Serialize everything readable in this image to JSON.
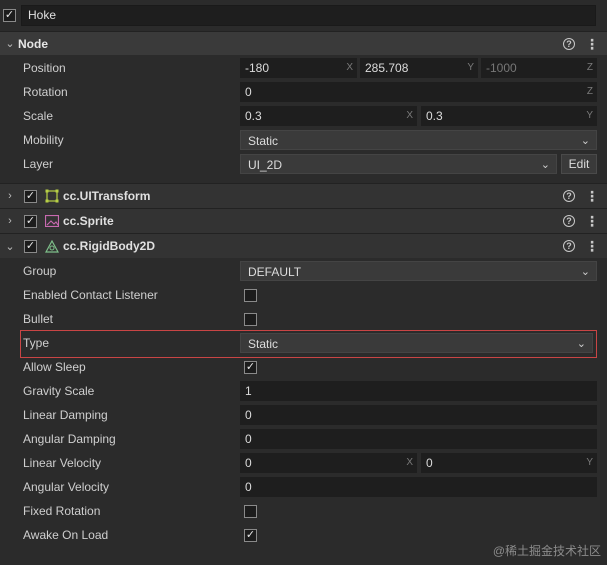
{
  "node_name": {
    "enabled": true,
    "value": "Hoke"
  },
  "node_section": {
    "title": "Node",
    "position": {
      "label": "Position",
      "x": "-180",
      "y": "285.708",
      "z": "-1000",
      "axis_x": "X",
      "axis_y": "Y",
      "axis_z": "Z"
    },
    "rotation": {
      "label": "Rotation",
      "z": "0",
      "axis_z": "Z"
    },
    "scale": {
      "label": "Scale",
      "x": "0.3",
      "y": "0.3",
      "axis_x": "X",
      "axis_y": "Y"
    },
    "mobility": {
      "label": "Mobility",
      "value": "Static"
    },
    "layer": {
      "label": "Layer",
      "value": "UI_2D",
      "edit_label": "Edit"
    }
  },
  "components": {
    "uitransform": {
      "title": "cc.UITransform",
      "enabled": true
    },
    "sprite": {
      "title": "cc.Sprite",
      "enabled": true
    },
    "rigidbody": {
      "title": "cc.RigidBody2D",
      "enabled": true
    }
  },
  "rigidbody_props": {
    "group": {
      "label": "Group",
      "value": "DEFAULT"
    },
    "contact_listener": {
      "label": "Enabled Contact Listener",
      "checked": false
    },
    "bullet": {
      "label": "Bullet",
      "checked": false
    },
    "type": {
      "label": "Type",
      "value": "Static"
    },
    "allow_sleep": {
      "label": "Allow Sleep",
      "checked": true
    },
    "gravity_scale": {
      "label": "Gravity Scale",
      "value": "1"
    },
    "linear_damping": {
      "label": "Linear Damping",
      "value": "0"
    },
    "angular_damping": {
      "label": "Angular Damping",
      "value": "0"
    },
    "linear_velocity": {
      "label": "Linear Velocity",
      "x": "0",
      "y": "0",
      "axis_x": "X",
      "axis_y": "Y"
    },
    "angular_velocity": {
      "label": "Angular Velocity",
      "value": "0"
    },
    "fixed_rotation": {
      "label": "Fixed Rotation",
      "checked": false
    },
    "awake_on_load": {
      "label": "Awake On Load",
      "checked": true
    }
  },
  "watermark": "@稀土掘金技术社区",
  "colors": {
    "highlight": "#c94545",
    "uitransform_icon": "#b8d046",
    "sprite_icon": "#c86ab0",
    "rigidbody_icon": "#7ec08a"
  }
}
